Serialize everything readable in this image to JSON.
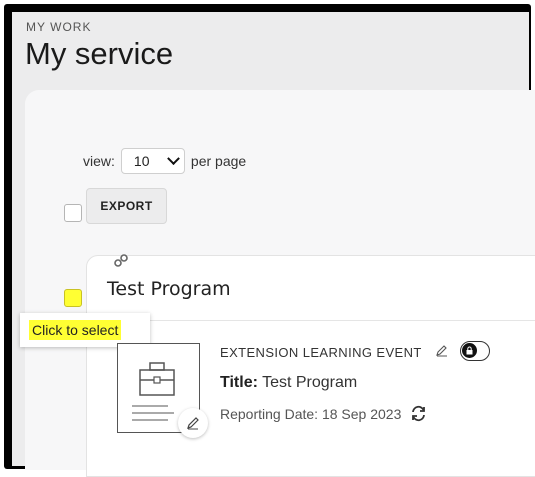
{
  "header": {
    "eyebrow": "MY WORK",
    "title": "My service"
  },
  "pagination": {
    "view_label": "view:",
    "per_page_value": "10",
    "per_page_suffix": "per page"
  },
  "toolbar": {
    "export_label": "EXPORT"
  },
  "program": {
    "name": "Test Program",
    "tooltip": "Click to select",
    "select_highlight_color": "#ffff33",
    "event": {
      "type": "EXTENSION LEARNING EVENT",
      "title_label": "Title:",
      "title_value": "Test Program",
      "reporting_date_label": "Reporting Date:",
      "reporting_date_value": "18 Sep 2023"
    }
  }
}
